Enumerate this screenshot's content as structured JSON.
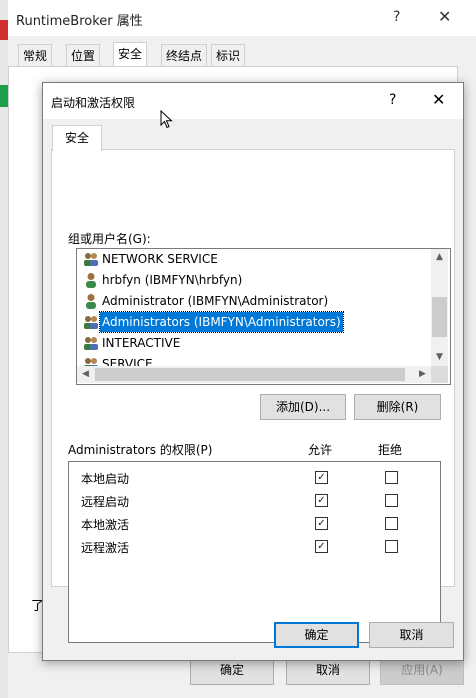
{
  "bg_window": {
    "title": "RuntimeBroker 属性",
    "tabs": [
      "常规",
      "位置",
      "安全",
      "终结点",
      "标识"
    ],
    "side_fragment": "了",
    "buttons": {
      "ok": "确定",
      "cancel": "取消",
      "apply": "应用(A)"
    }
  },
  "dialog": {
    "title": "启动和激活权限",
    "tab": "安全",
    "group_label": "组或用户名(G):",
    "users": [
      {
        "name": "NETWORK SERVICE",
        "icon": "group-icon"
      },
      {
        "name": "hrbfyn (IBMFYN\\hrbfyn)",
        "icon": "user-icon"
      },
      {
        "name": "Administrator (IBMFYN\\Administrator)",
        "icon": "user-icon"
      },
      {
        "name": "Administrators (IBMFYN\\Administrators)",
        "icon": "group-icon",
        "selected": true
      },
      {
        "name": "INTERACTIVE",
        "icon": "group-icon"
      },
      {
        "name": "SERVICE",
        "icon": "group-icon"
      }
    ],
    "add_button": "添加(D)...",
    "remove_button": "删除(R)",
    "perm_label": "Administrators 的权限(P)",
    "allow_header": "允许",
    "deny_header": "拒绝",
    "permissions": [
      {
        "name": "本地启动",
        "allow": true,
        "deny": false
      },
      {
        "name": "远程启动",
        "allow": true,
        "deny": false
      },
      {
        "name": "本地激活",
        "allow": true,
        "deny": false
      },
      {
        "name": "远程激活",
        "allow": true,
        "deny": false
      }
    ],
    "ok_button": "确定",
    "cancel_button": "取消"
  },
  "colors": {
    "selection": "#0078d7",
    "default_border": "#0078d7"
  },
  "icons": {
    "help": "?",
    "close": "✕",
    "check": "✓"
  }
}
